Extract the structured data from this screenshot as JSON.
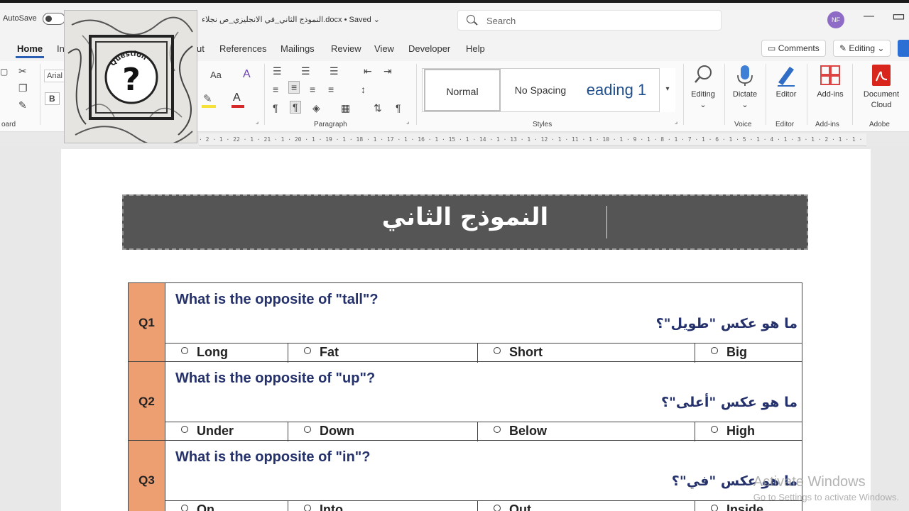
{
  "titlebar": {
    "autosave_label": "AutoSave",
    "doc_title": "النموذج الثاني_في الانجليزي_ص نجلاء.docx • Saved ⌄",
    "search_placeholder": "Search",
    "avatar_initials": "NF"
  },
  "tabs": [
    "Home",
    "In",
    "ut",
    "References",
    "Mailings",
    "Review",
    "View",
    "Developer",
    "Help"
  ],
  "top_actions": {
    "comments": "Comments",
    "editing": "✎ Editing ⌄"
  },
  "ribbon": {
    "font_name": "Arial",
    "bold": "B",
    "aa": "Aa",
    "groups": {
      "clipboard": "oard",
      "paragraph": "Paragraph",
      "styles": "Styles",
      "voice": "Voice",
      "editor": "Editor",
      "addins": "Add-ins",
      "adobe": "Adobe"
    },
    "styles": [
      "Normal",
      "No Spacing",
      "eading 1"
    ],
    "buttons": {
      "editing": "Editing",
      "dictate": "Dictate",
      "editor": "Editor",
      "addins": "Add-ins",
      "doc_cloud_1": "Document",
      "doc_cloud_2": "Cloud"
    }
  },
  "ruler_text": "· 2 · 1 · 22 · 1 · 21 · 1 · 20 · 1 · 19 · 1 · 18 · 1 · 17 · 1 · 16 · 1 · 15 · 1 · 14 · 1 · 13 · 1 · 12 · 1 · 11 · 1 · 10 · 1 · 9 · 1 · 8 · 1 · 7 · 1 · 6 · 1 · 5 · 1 · 4 · 1 · 3 · 1 · 2 · 1 · 1 · 1 ·",
  "document": {
    "heading": "النموذج الثاني",
    "questions": [
      {
        "num": "Q1",
        "en": "What is the opposite of \"tall\"?",
        "ar": "ما هو عكس \"طويل\"؟",
        "options": [
          "Long",
          "Fat",
          "Short",
          "Big"
        ]
      },
      {
        "num": "Q2",
        "en": "What is the opposite of \"up\"?",
        "ar": "ما هو عكس \"أعلى\"؟",
        "options": [
          "Under",
          "Down",
          "Below",
          "High"
        ]
      },
      {
        "num": "Q3",
        "en": "What is the opposite of \"in\"?",
        "ar": "ما هو عكس \"في\"؟",
        "options": [
          "On",
          "Into",
          "Out",
          "Inside"
        ]
      }
    ]
  },
  "thumbnail": {
    "caption": "Question"
  },
  "watermark": {
    "line1": "Activate Windows",
    "line2": "Go to Settings to activate Windows."
  }
}
